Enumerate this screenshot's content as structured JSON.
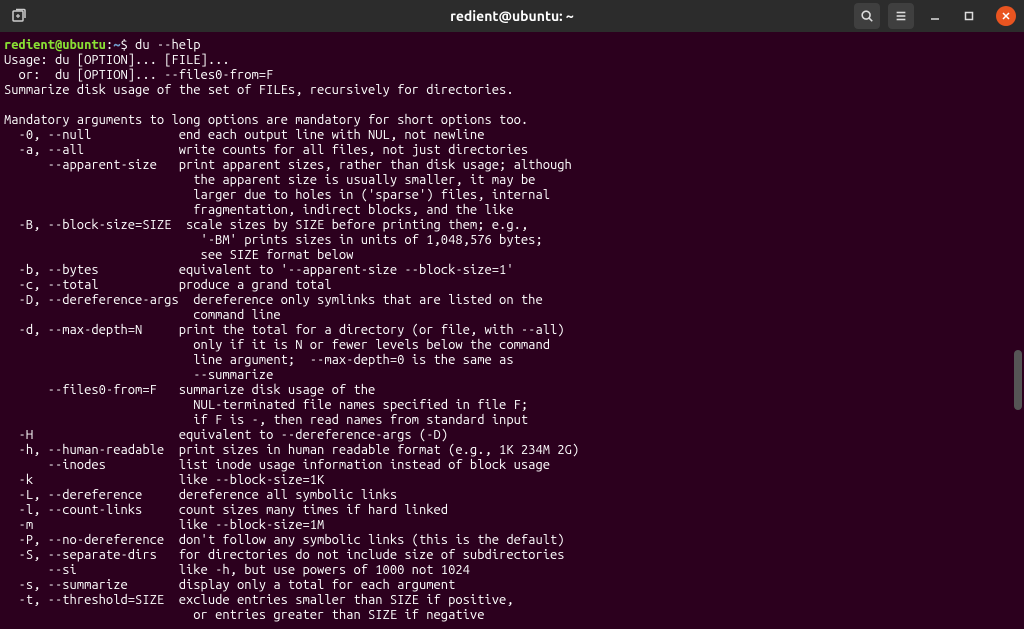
{
  "titlebar": {
    "title": "redient@ubuntu: ~"
  },
  "prompt": {
    "user_host": "redient@ubuntu",
    "path": "~",
    "command": "du --help"
  },
  "output_lines": [
    "Usage: du [OPTION]... [FILE]...",
    "  or:  du [OPTION]... --files0-from=F",
    "Summarize disk usage of the set of FILEs, recursively for directories.",
    "",
    "Mandatory arguments to long options are mandatory for short options too.",
    "  -0, --null            end each output line with NUL, not newline",
    "  -a, --all             write counts for all files, not just directories",
    "      --apparent-size   print apparent sizes, rather than disk usage; although",
    "                          the apparent size is usually smaller, it may be",
    "                          larger due to holes in ('sparse') files, internal",
    "                          fragmentation, indirect blocks, and the like",
    "  -B, --block-size=SIZE  scale sizes by SIZE before printing them; e.g.,",
    "                           '-BM' prints sizes in units of 1,048,576 bytes;",
    "                           see SIZE format below",
    "  -b, --bytes           equivalent to '--apparent-size --block-size=1'",
    "  -c, --total           produce a grand total",
    "  -D, --dereference-args  dereference only symlinks that are listed on the",
    "                          command line",
    "  -d, --max-depth=N     print the total for a directory (or file, with --all)",
    "                          only if it is N or fewer levels below the command",
    "                          line argument;  --max-depth=0 is the same as",
    "                          --summarize",
    "      --files0-from=F   summarize disk usage of the",
    "                          NUL-terminated file names specified in file F;",
    "                          if F is -, then read names from standard input",
    "  -H                    equivalent to --dereference-args (-D)",
    "  -h, --human-readable  print sizes in human readable format (e.g., 1K 234M 2G)",
    "      --inodes          list inode usage information instead of block usage",
    "  -k                    like --block-size=1K",
    "  -L, --dereference     dereference all symbolic links",
    "  -l, --count-links     count sizes many times if hard linked",
    "  -m                    like --block-size=1M",
    "  -P, --no-dereference  don't follow any symbolic links (this is the default)",
    "  -S, --separate-dirs   for directories do not include size of subdirectories",
    "      --si              like -h, but use powers of 1000 not 1024",
    "  -s, --summarize       display only a total for each argument",
    "  -t, --threshold=SIZE  exclude entries smaller than SIZE if positive,",
    "                          or entries greater than SIZE if negative"
  ]
}
